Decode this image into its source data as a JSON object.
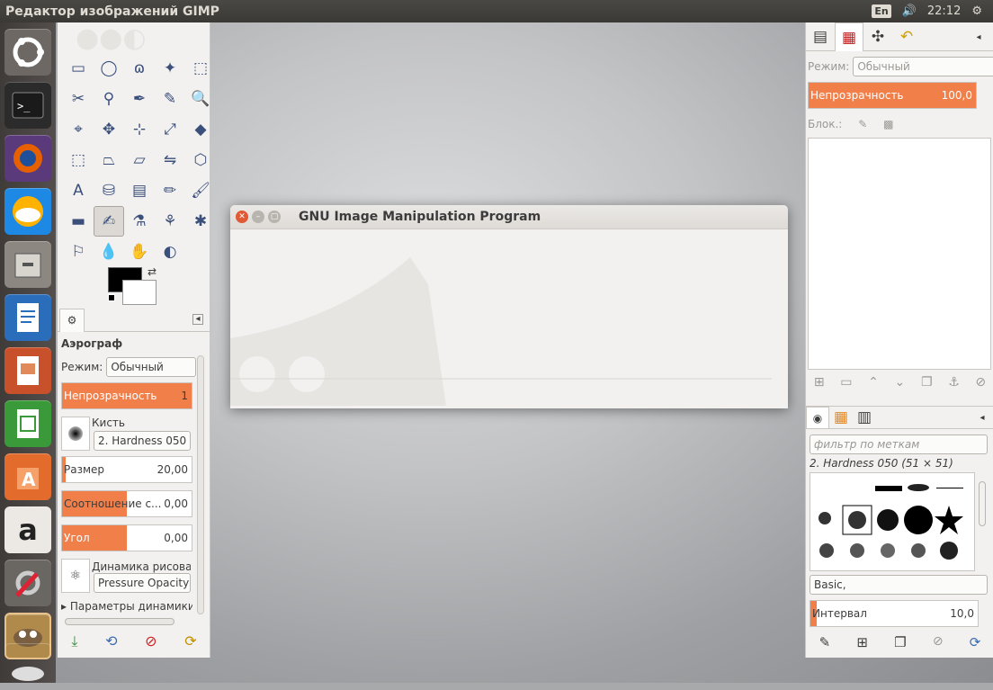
{
  "topbar": {
    "title": "Редактор изображений GIMP",
    "lang": "En",
    "volume_icon": "speaker-icon",
    "time": "22:12",
    "settings_icon": "gear-icon"
  },
  "launcher": {
    "items": [
      {
        "name": "ubuntu-dash",
        "color": "#7a756f"
      },
      {
        "name": "terminal",
        "color": "#2c2c2c"
      },
      {
        "name": "firefox",
        "color": "#e66000"
      },
      {
        "name": "cloud",
        "color": "#1e88e5"
      },
      {
        "name": "files",
        "color": "#8c8780"
      },
      {
        "name": "writer",
        "color": "#2a6ebb"
      },
      {
        "name": "impress",
        "color": "#c8502a"
      },
      {
        "name": "calc",
        "color": "#3a9a3a"
      },
      {
        "name": "software-center",
        "color": "#e36c2c"
      },
      {
        "name": "amazon",
        "color": "#ece9e4"
      },
      {
        "name": "system-settings",
        "color": "#6a6662"
      },
      {
        "name": "gimp",
        "color": "#8a6a3a"
      },
      {
        "name": "dvd",
        "color": "#d8d8d8"
      }
    ],
    "amazon_label": "a"
  },
  "toolbox": {
    "tools": [
      "▭",
      "◯",
      "ɷ",
      "✦",
      "⬚",
      "✂",
      "⚲",
      "✒",
      "✎",
      "🔍",
      "⌖",
      "✥",
      "⊹",
      "⤢",
      "◆",
      "⬚",
      "⏢",
      "⏥",
      "⇋",
      "⬡",
      "A",
      "⛁",
      "▤",
      "✏",
      "🖌",
      "▬",
      "✍",
      "⚗",
      "⚘",
      "✱",
      "⚐",
      "💧",
      "✋",
      "◐"
    ],
    "selected_index": 26,
    "options_title": "Аэрограф",
    "mode_label": "Режим:",
    "mode_value": "Обычный",
    "opacity_label": "Непрозрачность",
    "opacity_value": "1",
    "brush_label": "Кисть",
    "brush_value": "2. Hardness 050",
    "size_label": "Размер",
    "size_value": "20,00",
    "ratio_label": "Соотношение с...",
    "ratio_value": "0,00",
    "angle_label": "Угол",
    "angle_value": "0,00",
    "dynamics_label": "Динамика рисовани",
    "dynamics_value": "Pressure Opacity",
    "dynamics_params": "Параметры динамики"
  },
  "dialog": {
    "title": "GNU Image Manipulation Program"
  },
  "dock": {
    "mode_label": "Режим:",
    "mode_value": "Обычный",
    "opacity_label": "Непрозрачность",
    "opacity_value": "100,0",
    "lock_label": "Блок.:",
    "filter_placeholder": "фильтр по меткам",
    "brush_name": "2. Hardness 050 (51 × 51)",
    "brush_set": "Basic,",
    "spacing_label": "Интервал",
    "spacing_value": "10,0"
  },
  "colors": {
    "accent": "#f07f4a",
    "panel": "#f2f1f0",
    "topbar": "#3c3b37"
  }
}
